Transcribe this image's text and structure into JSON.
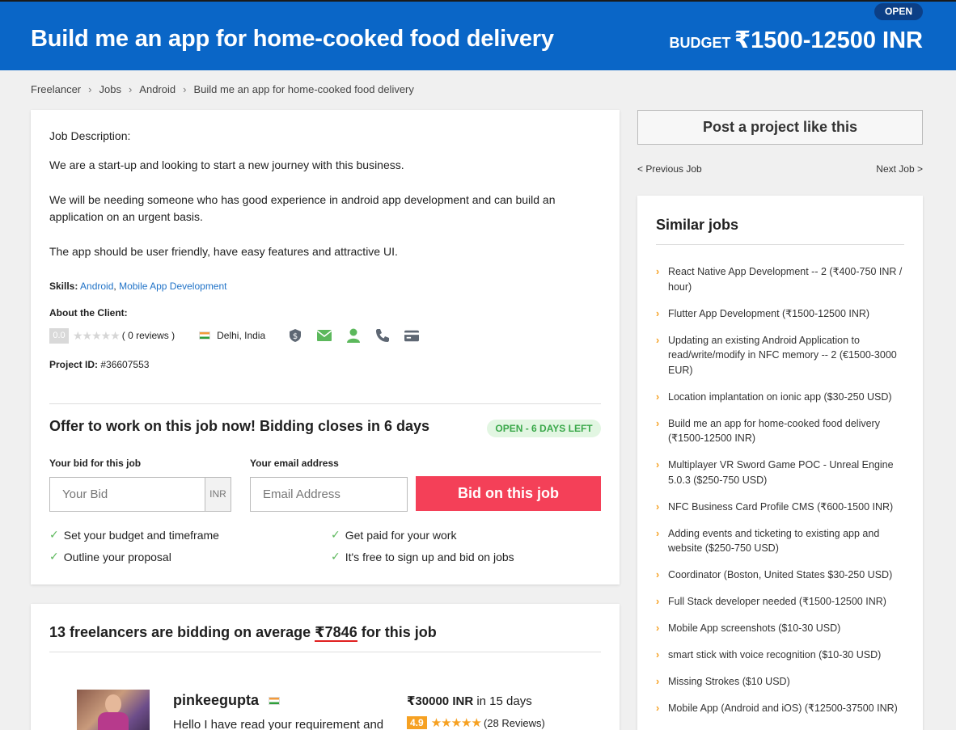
{
  "header": {
    "title": "Build me an app for home-cooked food delivery",
    "budget_label": "BUDGET",
    "budget_value": "₹1500-12500 INR",
    "status": "OPEN"
  },
  "breadcrumb": [
    "Freelancer",
    "Jobs",
    "Android",
    "Build me an app for home-cooked food delivery"
  ],
  "job": {
    "description_label": "Job Description:",
    "paragraphs": [
      "We are a start-up and looking to start a new journey with this business.",
      "We will be needing someone who has good experience in android app development and can build an application on an urgent basis.",
      "The app should be user friendly, have easy features and attractive UI."
    ],
    "skills_label": "Skills:",
    "skills": [
      "Android",
      "Mobile App Development"
    ],
    "about_label": "About the Client:",
    "client_rating": "0.0",
    "client_reviews": "( 0 reviews )",
    "client_location": "Delhi, India",
    "project_id_label": "Project ID:",
    "project_id": "#36607553"
  },
  "offer": {
    "title": "Offer to work on this job now! Bidding closes in 6 days",
    "status": "OPEN - 6 DAYS LEFT",
    "bid_label": "Your bid for this job",
    "bid_placeholder": "Your Bid",
    "bid_currency": "INR",
    "email_label": "Your email address",
    "email_placeholder": "Email Address",
    "button": "Bid on this job",
    "benefits": [
      "Set your budget and timeframe",
      "Get paid for your work",
      "Outline your proposal",
      "It's free to sign up and bid on jobs"
    ]
  },
  "bidders": {
    "title_before": "13 freelancers are bidding on average ",
    "average": "₹7846",
    "title_after": " for this job",
    "first": {
      "name": "pinkeegupta",
      "text": "Hello I have read your requirement and",
      "amount": "₹30000 INR",
      "duration": " in 15 days",
      "rating": "4.9",
      "reviews": "(28 Reviews)"
    }
  },
  "sidebar": {
    "post_button": "Post a project like this",
    "prev_job": "< Previous Job",
    "next_job": "Next Job >",
    "similar_title": "Similar jobs",
    "similar_jobs": [
      "React Native App Development -- 2 (₹400-750 INR / hour)",
      "Flutter App Development (₹1500-12500 INR)",
      "Updating an existing Android Application to read/write/modify in NFC memory -- 2 (€1500-3000 EUR)",
      "Location implantation on ionic app ($30-250 USD)",
      "Build me an app for home-cooked food delivery (₹1500-12500 INR)",
      "Multiplayer VR Sword Game POC - Unreal Engine 5.0.3 ($250-750 USD)",
      "NFC Business Card Profile CMS (₹600-1500 INR)",
      "Adding events and ticketing to existing app and website ($250-750 USD)",
      "Coordinator (Boston, United States $30-250 USD)",
      "Full Stack developer needed (₹1500-12500 INR)",
      "Mobile App screenshots ($10-30 USD)",
      "smart stick with voice recognition ($10-30 USD)",
      "Missing Strokes ($10 USD)",
      "Mobile App (Android and iOS) (₹12500-37500 INR)"
    ]
  },
  "colors": {
    "header_bg": "#0a66c7",
    "bid_button": "#f44058",
    "open_green": "#3aa84a",
    "link_blue": "#1f72c7"
  }
}
